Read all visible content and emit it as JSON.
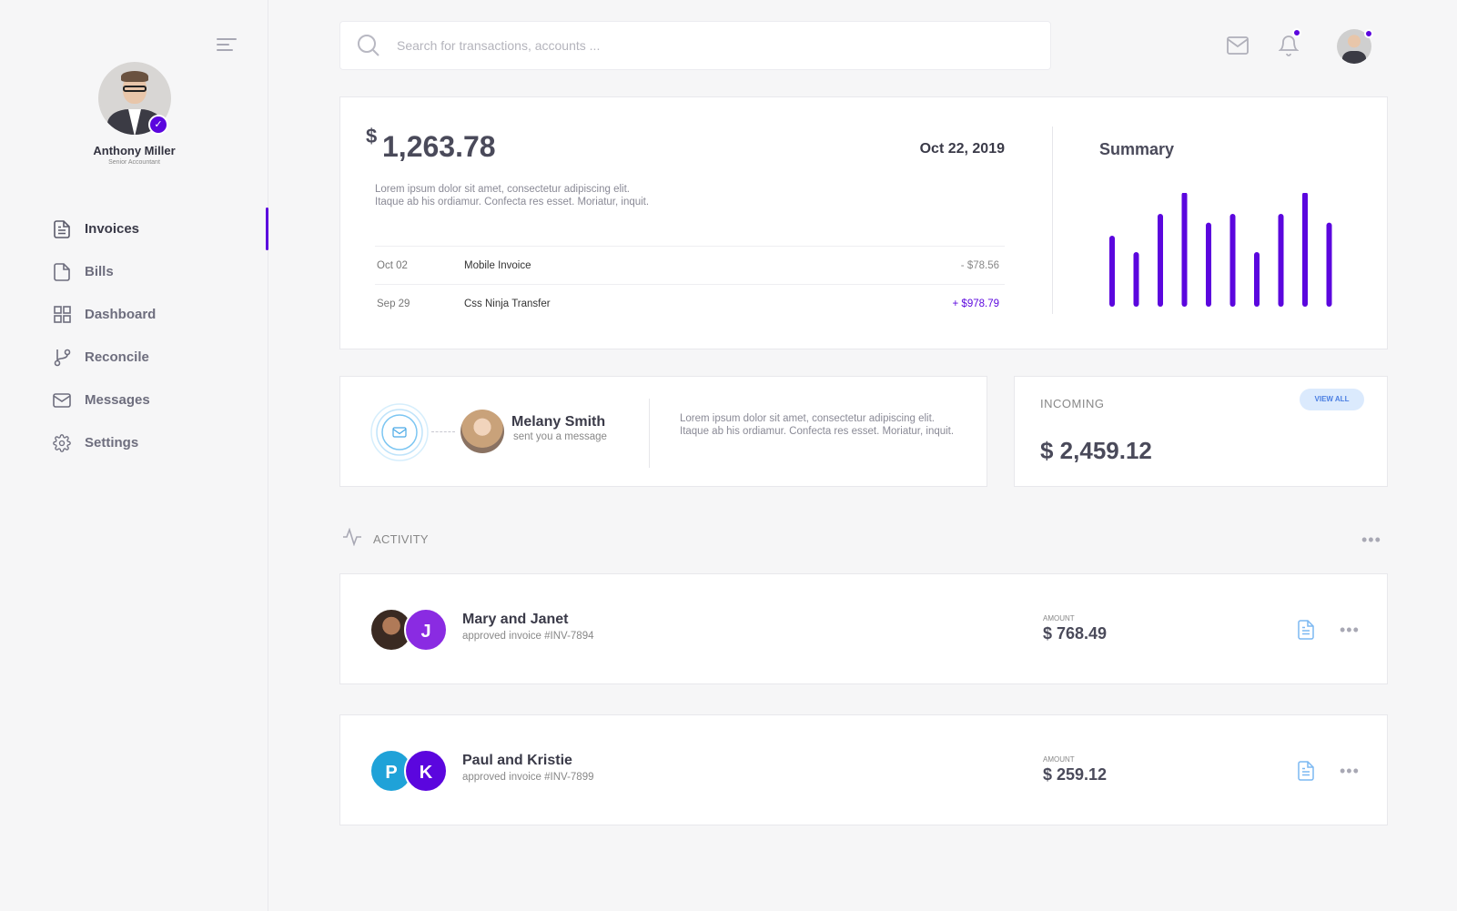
{
  "sidebar": {
    "profile": {
      "name": "Anthony Miller",
      "role": "Senior Accountant"
    },
    "nav": [
      {
        "label": "Invoices",
        "icon": "file-text-icon",
        "active": true
      },
      {
        "label": "Bills",
        "icon": "file-icon"
      },
      {
        "label": "Dashboard",
        "icon": "grid-icon"
      },
      {
        "label": "Reconcile",
        "icon": "git-branch-icon"
      },
      {
        "label": "Messages",
        "icon": "mail-icon"
      },
      {
        "label": "Settings",
        "icon": "gear-icon"
      }
    ]
  },
  "search": {
    "placeholder": "Search for transactions, accounts ..."
  },
  "balance": {
    "currency": "$",
    "amount": "1,263.78",
    "date": "Oct 22, 2019",
    "description": "Lorem ipsum dolor sit amet, consectetur adipiscing elit. Itaque ab his ordiamur. Confecta res esset. Moriatur, inquit.",
    "transactions": [
      {
        "date": "Oct 02",
        "name": "Mobile Invoice",
        "amount": "- $78.56",
        "positive": false
      },
      {
        "date": "Sep 29",
        "name": "Css Ninja Transfer",
        "amount": "+ $978.79",
        "positive": true
      }
    ],
    "summary_title": "Summary"
  },
  "chart_data": {
    "type": "bar",
    "values": [
      60,
      45,
      80,
      100,
      72,
      80,
      45,
      80,
      100,
      72
    ],
    "ylim": [
      0,
      100
    ],
    "color": "#5b06de"
  },
  "message": {
    "sender": "Melany Smith",
    "subtitle": "sent you a message",
    "text": "Lorem ipsum dolor sit amet, consectetur adipiscing elit. Itaque ab his ordiamur. Confecta res esset. Moriatur, inquit."
  },
  "incoming": {
    "label": "INCOMING",
    "view_all": "VIEW ALL",
    "amount": "$ 2,459.12"
  },
  "activity": {
    "label": "ACTIVITY",
    "items": [
      {
        "title": "Mary and Janet",
        "subtitle": "approved invoice #INV-7894",
        "amount_label": "AMOUNT",
        "amount": "$ 768.49",
        "initial2": "J",
        "color2": "#8a2be2"
      },
      {
        "title": "Paul and Kristie",
        "subtitle": "approved invoice #INV-7899",
        "amount_label": "AMOUNT",
        "amount": "$ 259.12",
        "initial1": "P",
        "color1": "#1fa2d8",
        "initial2": "K",
        "color2": "#5b06de"
      }
    ]
  },
  "colors": {
    "accent": "#5b06de",
    "link": "#4a7ee2"
  }
}
